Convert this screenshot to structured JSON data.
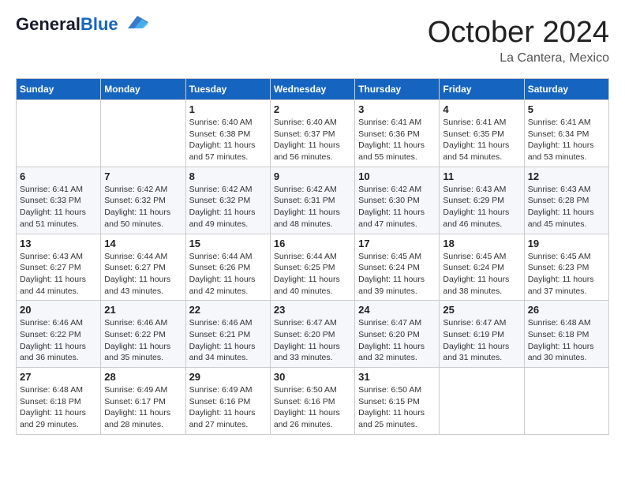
{
  "header": {
    "logo_line1": "General",
    "logo_line2": "Blue",
    "month": "October 2024",
    "location": "La Cantera, Mexico"
  },
  "days_of_week": [
    "Sunday",
    "Monday",
    "Tuesday",
    "Wednesday",
    "Thursday",
    "Friday",
    "Saturday"
  ],
  "weeks": [
    [
      {
        "day": "",
        "info": ""
      },
      {
        "day": "",
        "info": ""
      },
      {
        "day": "1",
        "info": "Sunrise: 6:40 AM\nSunset: 6:38 PM\nDaylight: 11 hours and 57 minutes."
      },
      {
        "day": "2",
        "info": "Sunrise: 6:40 AM\nSunset: 6:37 PM\nDaylight: 11 hours and 56 minutes."
      },
      {
        "day": "3",
        "info": "Sunrise: 6:41 AM\nSunset: 6:36 PM\nDaylight: 11 hours and 55 minutes."
      },
      {
        "day": "4",
        "info": "Sunrise: 6:41 AM\nSunset: 6:35 PM\nDaylight: 11 hours and 54 minutes."
      },
      {
        "day": "5",
        "info": "Sunrise: 6:41 AM\nSunset: 6:34 PM\nDaylight: 11 hours and 53 minutes."
      }
    ],
    [
      {
        "day": "6",
        "info": "Sunrise: 6:41 AM\nSunset: 6:33 PM\nDaylight: 11 hours and 51 minutes."
      },
      {
        "day": "7",
        "info": "Sunrise: 6:42 AM\nSunset: 6:32 PM\nDaylight: 11 hours and 50 minutes."
      },
      {
        "day": "8",
        "info": "Sunrise: 6:42 AM\nSunset: 6:32 PM\nDaylight: 11 hours and 49 minutes."
      },
      {
        "day": "9",
        "info": "Sunrise: 6:42 AM\nSunset: 6:31 PM\nDaylight: 11 hours and 48 minutes."
      },
      {
        "day": "10",
        "info": "Sunrise: 6:42 AM\nSunset: 6:30 PM\nDaylight: 11 hours and 47 minutes."
      },
      {
        "day": "11",
        "info": "Sunrise: 6:43 AM\nSunset: 6:29 PM\nDaylight: 11 hours and 46 minutes."
      },
      {
        "day": "12",
        "info": "Sunrise: 6:43 AM\nSunset: 6:28 PM\nDaylight: 11 hours and 45 minutes."
      }
    ],
    [
      {
        "day": "13",
        "info": "Sunrise: 6:43 AM\nSunset: 6:27 PM\nDaylight: 11 hours and 44 minutes."
      },
      {
        "day": "14",
        "info": "Sunrise: 6:44 AM\nSunset: 6:27 PM\nDaylight: 11 hours and 43 minutes."
      },
      {
        "day": "15",
        "info": "Sunrise: 6:44 AM\nSunset: 6:26 PM\nDaylight: 11 hours and 42 minutes."
      },
      {
        "day": "16",
        "info": "Sunrise: 6:44 AM\nSunset: 6:25 PM\nDaylight: 11 hours and 40 minutes."
      },
      {
        "day": "17",
        "info": "Sunrise: 6:45 AM\nSunset: 6:24 PM\nDaylight: 11 hours and 39 minutes."
      },
      {
        "day": "18",
        "info": "Sunrise: 6:45 AM\nSunset: 6:24 PM\nDaylight: 11 hours and 38 minutes."
      },
      {
        "day": "19",
        "info": "Sunrise: 6:45 AM\nSunset: 6:23 PM\nDaylight: 11 hours and 37 minutes."
      }
    ],
    [
      {
        "day": "20",
        "info": "Sunrise: 6:46 AM\nSunset: 6:22 PM\nDaylight: 11 hours and 36 minutes."
      },
      {
        "day": "21",
        "info": "Sunrise: 6:46 AM\nSunset: 6:22 PM\nDaylight: 11 hours and 35 minutes."
      },
      {
        "day": "22",
        "info": "Sunrise: 6:46 AM\nSunset: 6:21 PM\nDaylight: 11 hours and 34 minutes."
      },
      {
        "day": "23",
        "info": "Sunrise: 6:47 AM\nSunset: 6:20 PM\nDaylight: 11 hours and 33 minutes."
      },
      {
        "day": "24",
        "info": "Sunrise: 6:47 AM\nSunset: 6:20 PM\nDaylight: 11 hours and 32 minutes."
      },
      {
        "day": "25",
        "info": "Sunrise: 6:47 AM\nSunset: 6:19 PM\nDaylight: 11 hours and 31 minutes."
      },
      {
        "day": "26",
        "info": "Sunrise: 6:48 AM\nSunset: 6:18 PM\nDaylight: 11 hours and 30 minutes."
      }
    ],
    [
      {
        "day": "27",
        "info": "Sunrise: 6:48 AM\nSunset: 6:18 PM\nDaylight: 11 hours and 29 minutes."
      },
      {
        "day": "28",
        "info": "Sunrise: 6:49 AM\nSunset: 6:17 PM\nDaylight: 11 hours and 28 minutes."
      },
      {
        "day": "29",
        "info": "Sunrise: 6:49 AM\nSunset: 6:16 PM\nDaylight: 11 hours and 27 minutes."
      },
      {
        "day": "30",
        "info": "Sunrise: 6:50 AM\nSunset: 6:16 PM\nDaylight: 11 hours and 26 minutes."
      },
      {
        "day": "31",
        "info": "Sunrise: 6:50 AM\nSunset: 6:15 PM\nDaylight: 11 hours and 25 minutes."
      },
      {
        "day": "",
        "info": ""
      },
      {
        "day": "",
        "info": ""
      }
    ]
  ]
}
